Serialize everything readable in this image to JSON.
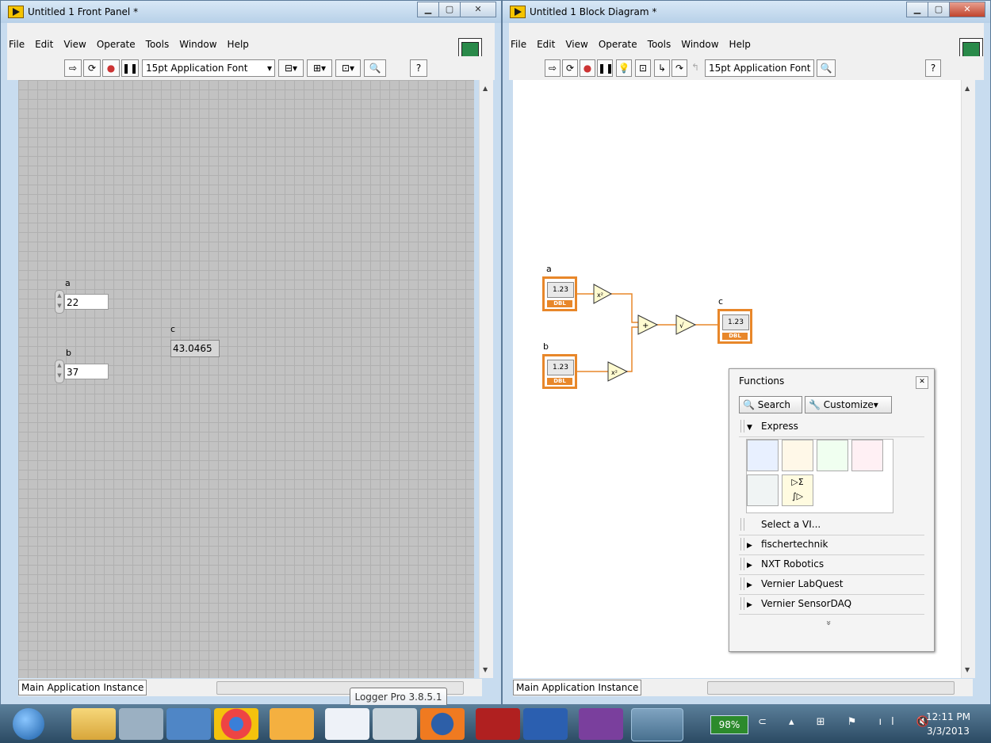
{
  "front_panel": {
    "title": "Untitled 1 Front Panel *",
    "menu": [
      "File",
      "Edit",
      "View",
      "Operate",
      "Tools",
      "Window",
      "Help"
    ],
    "font_selector": "15pt Application Font",
    "controls": {
      "a_label": "a",
      "a_value": "22",
      "b_label": "b",
      "b_value": "37",
      "c_label": "c",
      "c_value": "43.0465"
    },
    "status": "Main Application Instance"
  },
  "block_diagram": {
    "title": "Untitled 1 Block Diagram *",
    "menu": [
      "File",
      "Edit",
      "View",
      "Operate",
      "Tools",
      "Window",
      "Help"
    ],
    "font_selector": "15pt Application Font",
    "terminal_a_label": "a",
    "terminal_b_label": "b",
    "terminal_c_label": "c",
    "terminal_text": "1.23",
    "terminal_type": "DBL",
    "square_label": "x²",
    "add_label": "+",
    "sqrt_label": "√",
    "status": "Main Application Instance"
  },
  "functions_palette": {
    "title": "Functions",
    "search": "Search",
    "customize": "Customize",
    "express": "Express",
    "items": [
      "Select a VI...",
      "fischertechnik",
      "NXT Robotics",
      "Vernier LabQuest",
      "Vernier SensorDAQ"
    ],
    "more": "»"
  },
  "tooltip": "Logger Pro 3.8.5.1",
  "taskbar": {
    "battery": "98%",
    "time": "12:11 PM",
    "date": "3/3/2013"
  },
  "colors": {
    "wire": "#e8872a",
    "panel_bg": "#c2c2c2"
  }
}
